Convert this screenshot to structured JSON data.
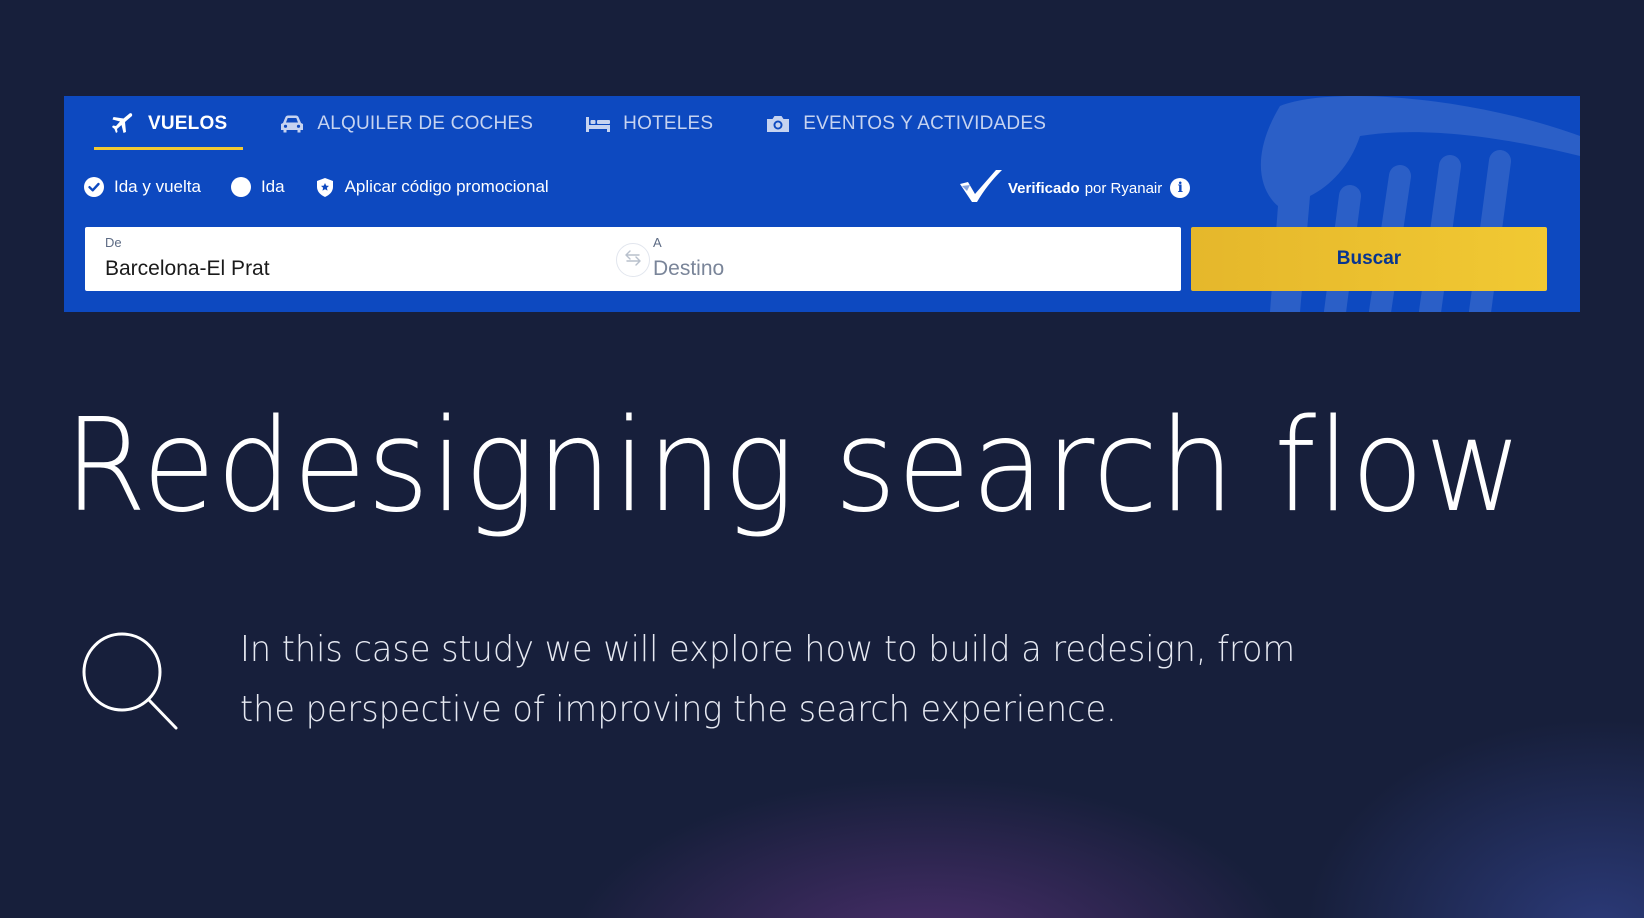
{
  "widget": {
    "tabs": [
      {
        "label": "VUELOS",
        "icon": "plane-icon",
        "active": true
      },
      {
        "label": "ALQUILER DE COCHES",
        "icon": "car-icon",
        "active": false
      },
      {
        "label": "HOTELES",
        "icon": "bed-icon",
        "active": false
      },
      {
        "label": "EVENTOS Y ACTIVIDADES",
        "icon": "camera-icon",
        "active": false
      }
    ],
    "options": {
      "round_trip": "Ida y vuelta",
      "one_way": "Ida",
      "promo": "Aplicar código promocional"
    },
    "verified": {
      "strong": "Verificado",
      "rest": "por Ryanair",
      "info_glyph": "i"
    },
    "from": {
      "label": "De",
      "value": "Barcelona-El Prat"
    },
    "to": {
      "label": "A",
      "placeholder": "Destino"
    },
    "search_button": "Buscar",
    "colors": {
      "brand_blue": "#0d49c0",
      "accent_yellow": "#f1c933",
      "button_text": "#073590",
      "background": "#171f3b"
    }
  },
  "headline": "Redesigning search flow",
  "description": "In this case study we will explore how to build a redesign, from the perspective of improving the search experience.",
  "decor_icon": "magnifier-icon"
}
